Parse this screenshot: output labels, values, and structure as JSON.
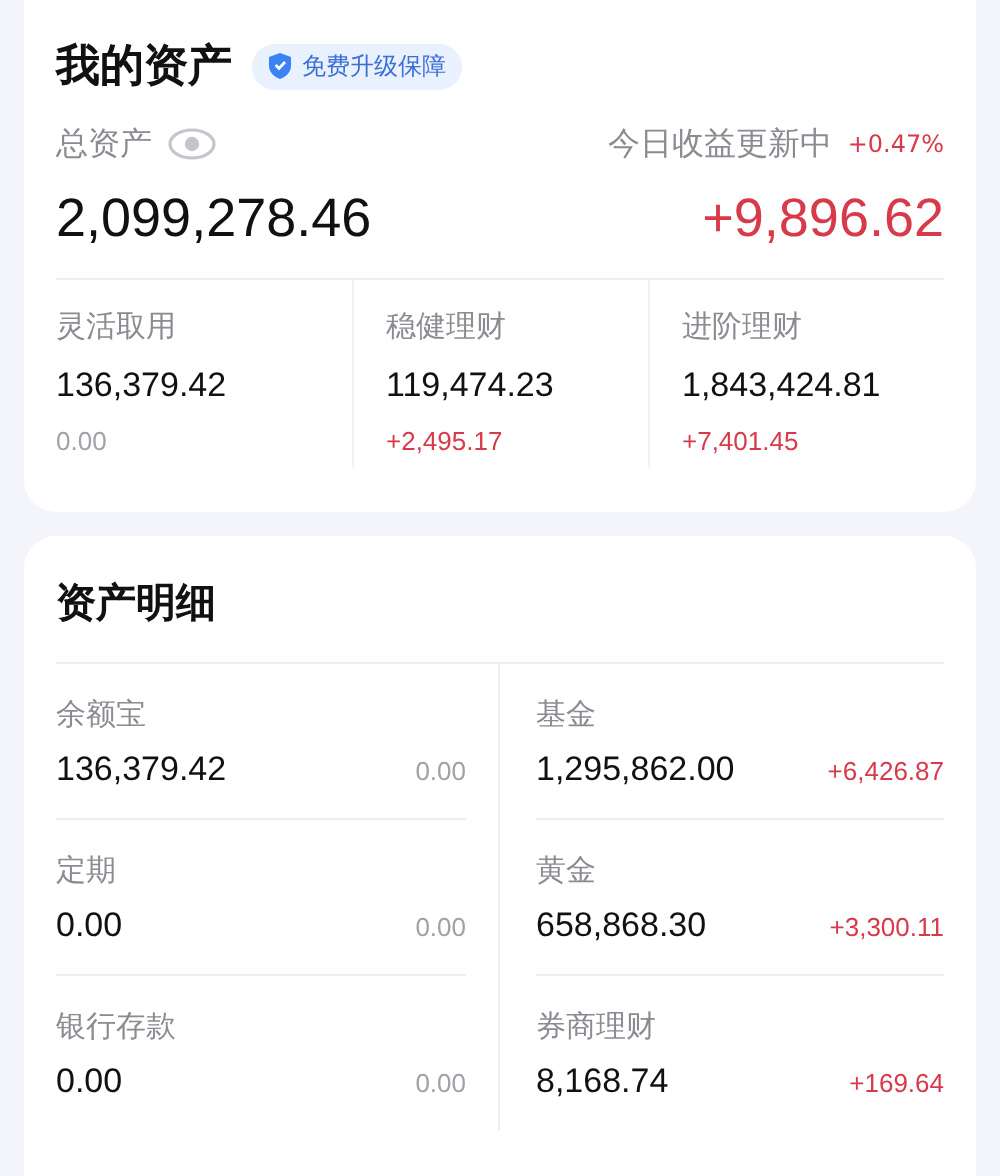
{
  "header": {
    "title": "我的资产",
    "badge": "免费升级保障"
  },
  "total": {
    "label": "总资产",
    "value": "2,099,278.46"
  },
  "today": {
    "label": "今日收益更新中",
    "rate": "+0.47%",
    "value": "+9,896.62"
  },
  "categories": [
    {
      "label": "灵活取用",
      "value": "136,379.42",
      "change": "0.00",
      "color": "#a0a2a8"
    },
    {
      "label": "稳健理财",
      "value": "119,474.23",
      "change": "+2,495.17",
      "color": "#d73a4a"
    },
    {
      "label": "进阶理财",
      "value": "1,843,424.81",
      "change": "+7,401.45",
      "color": "#d73a4a"
    }
  ],
  "details": {
    "title": "资产明细",
    "left": [
      {
        "label": "余额宝",
        "value": "136,379.42",
        "change": "0.00",
        "color": "#a0a2a8"
      },
      {
        "label": "定期",
        "value": "0.00",
        "change": "0.00",
        "color": "#a0a2a8"
      },
      {
        "label": "银行存款",
        "value": "0.00",
        "change": "0.00",
        "color": "#a0a2a8"
      }
    ],
    "right": [
      {
        "label": "基金",
        "value": "1,295,862.00",
        "change": "+6,426.87",
        "color": "#d73a4a"
      },
      {
        "label": "黄金",
        "value": "658,868.30",
        "change": "+3,300.11",
        "color": "#d73a4a"
      },
      {
        "label": "券商理财",
        "value": "8,168.74",
        "change": "+169.64",
        "color": "#d73a4a"
      }
    ]
  }
}
